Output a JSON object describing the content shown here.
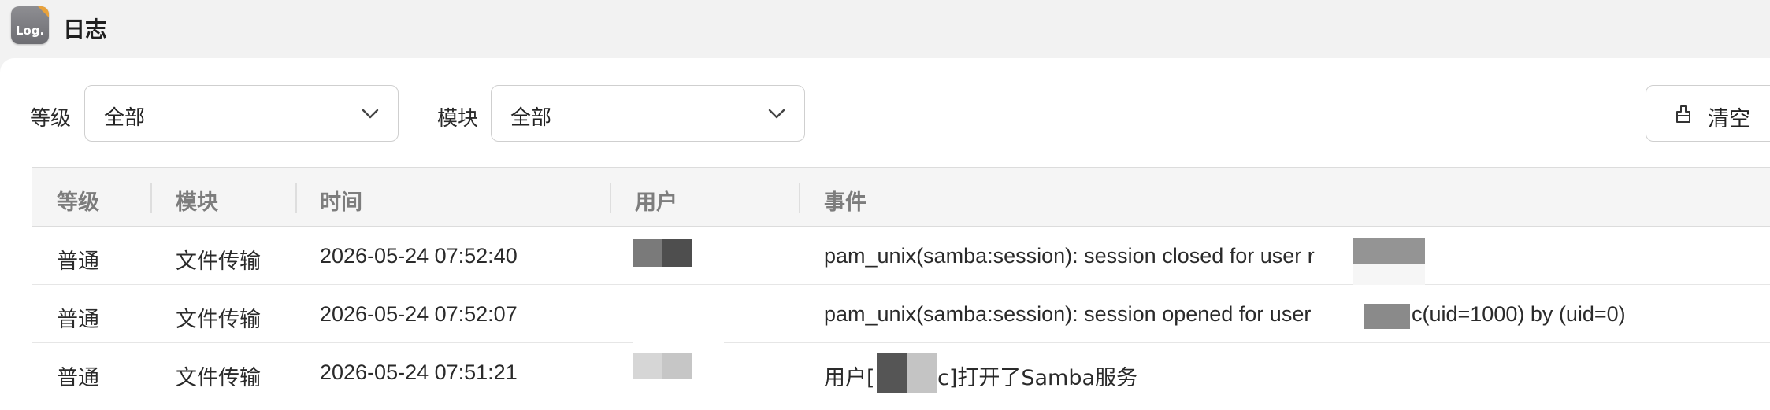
{
  "window": {
    "title": "日志",
    "icon_name": "log-app-icon",
    "icon_text": "Log."
  },
  "filters": {
    "level_label": "等级",
    "level_value": "全部",
    "module_label": "模块",
    "module_value": "全部"
  },
  "toolbar": {
    "clear_label": "清空",
    "clear_icon": "broom-icon"
  },
  "table": {
    "headers": {
      "level": "等级",
      "module": "模块",
      "time": "时间",
      "user": "用户",
      "event": "事件"
    },
    "rows": [
      {
        "level": "普通",
        "module": "文件传输",
        "time": "2026-05-24 07:52:40",
        "event": "pam_unix(samba:session): session closed for user r"
      },
      {
        "level": "普通",
        "module": "文件传输",
        "time": "2026-05-24 07:52:07",
        "event_prefix": "pam_unix(samba:session): session opened for user ",
        "event_suffix": "c(uid=1000) by (uid=0)"
      },
      {
        "level": "普通",
        "module": "文件传输",
        "time": "2026-05-24 07:51:21",
        "event_prefix": "用户[",
        "event_suffix": "c]打开了Samba服务"
      }
    ]
  },
  "colors": {
    "titlebar_bg": "#f2f2f2",
    "panel_bg": "#ffffff",
    "header_bg": "#f5f5f5",
    "header_text": "#7d7d7d",
    "redaction_dark": "#555555",
    "redaction_mid": "#8a8a8a",
    "redaction_light": "#cccccc"
  }
}
